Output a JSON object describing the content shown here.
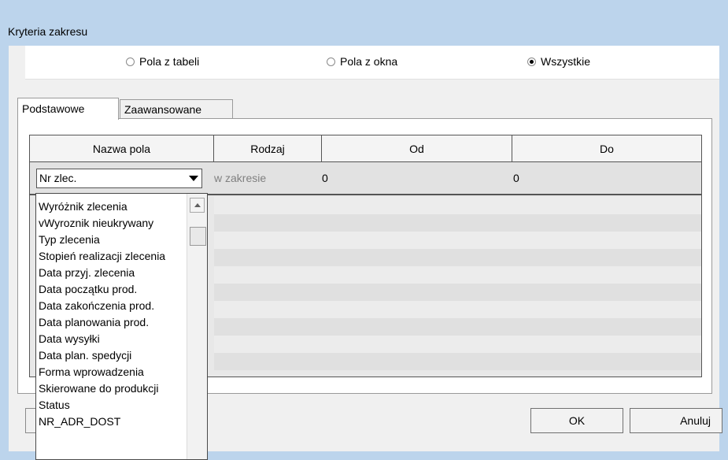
{
  "window": {
    "title": "Kryteria zakresu"
  },
  "radio": {
    "options": [
      {
        "label": "Pola z tabeli",
        "checked": false
      },
      {
        "label": "Pola z okna",
        "checked": false
      },
      {
        "label": "Wszystkie",
        "checked": true
      }
    ]
  },
  "tabs": [
    {
      "label": "Podstawowe",
      "active": true
    },
    {
      "label": "Zaawansowane",
      "active": false
    }
  ],
  "grid": {
    "columns": [
      "Nazwa pola",
      "Rodzaj",
      "Od",
      "Do"
    ],
    "row": {
      "field": "Nr zlec.",
      "kind": "w zakresie",
      "from": "0",
      "to": "0"
    }
  },
  "dropdown": {
    "items": [
      "Wyróżnik zlecenia",
      "vWyroznik nieukrywany",
      "Typ zlecenia",
      "Stopień realizacji zlecenia",
      "Data przyj. zlecenia",
      "Data początku prod.",
      "Data zakończenia prod.",
      "Data planowania prod.",
      "Data wysyłki",
      "Data plan. spedycji",
      "Forma wprowadzenia",
      "Skierowane do produkcji",
      "Status",
      "NR_ADR_DOST"
    ]
  },
  "buttons": {
    "ok": "OK",
    "cancel": "Anuluj"
  }
}
